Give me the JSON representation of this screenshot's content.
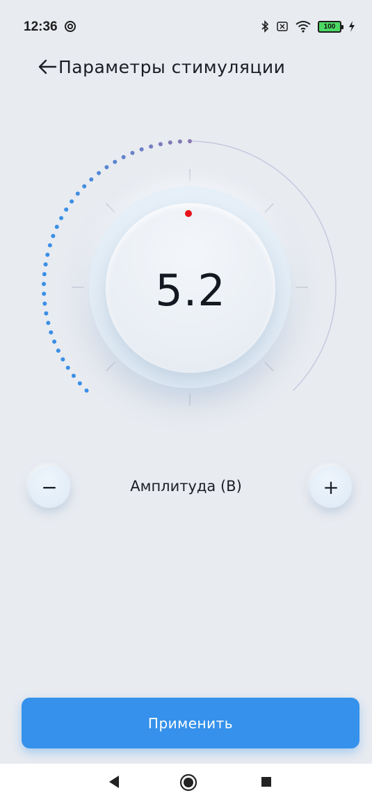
{
  "status_bar": {
    "time": "12:36",
    "battery": "100",
    "icons": [
      "sync-icon",
      "bluetooth-icon",
      "sim-icon",
      "wifi-icon",
      "battery-icon",
      "charging-icon"
    ]
  },
  "header": {
    "back_icon": "arrow-left-icon",
    "title": "Параметры стимуляции"
  },
  "dial": {
    "value": "5.2",
    "fill_fraction": 0.52,
    "colors": {
      "progress_start": "#3a8fe6",
      "progress_end": "#8a78b0",
      "track": "#c6c9de",
      "indicator": "#e8121a"
    }
  },
  "amplitude": {
    "label": "Амплитуда (В)",
    "minus_label": "−",
    "plus_label": "+"
  },
  "apply_button": {
    "label": "Применить",
    "color": "#3591eb"
  },
  "nav_bar": {
    "icons": [
      "back-triangle-icon",
      "home-circle-icon",
      "recent-square-icon"
    ]
  }
}
